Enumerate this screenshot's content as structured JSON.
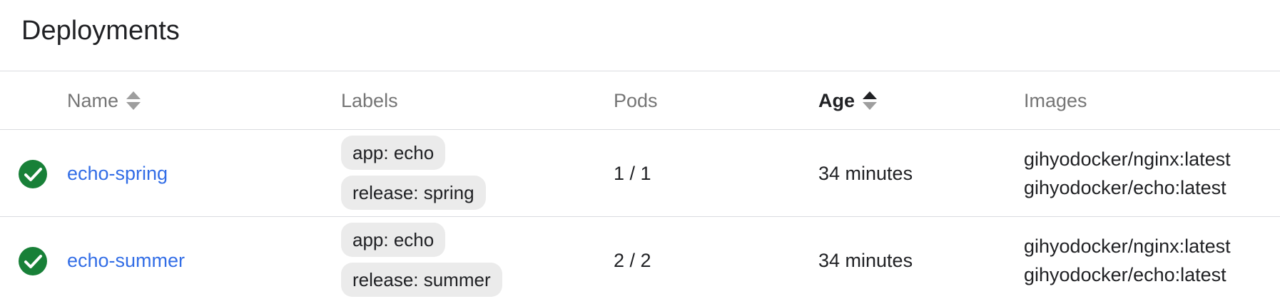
{
  "header": {
    "title": "Deployments"
  },
  "table": {
    "columns": {
      "name": "Name",
      "labels": "Labels",
      "pods": "Pods",
      "age": "Age",
      "images": "Images"
    },
    "sort": {
      "active_column": "Age",
      "direction": "ascending"
    },
    "rows": [
      {
        "status": "check-circle-icon",
        "name": "echo-spring",
        "labels": [
          "app: echo",
          "release: spring"
        ],
        "pods": "1 / 1",
        "age": "34 minutes",
        "images": [
          "gihyodocker/nginx:latest",
          "gihyodocker/echo:latest"
        ]
      },
      {
        "status": "check-circle-icon",
        "name": "echo-summer",
        "labels": [
          "app: echo",
          "release: summer"
        ],
        "pods": "2 / 2",
        "age": "34 minutes",
        "images": [
          "gihyodocker/nginx:latest",
          "gihyodocker/echo:latest"
        ]
      }
    ]
  },
  "colors": {
    "status_ok": "#188038",
    "link": "#326de6",
    "chip_bg": "#ebebeb",
    "divider": "#dadce0"
  }
}
